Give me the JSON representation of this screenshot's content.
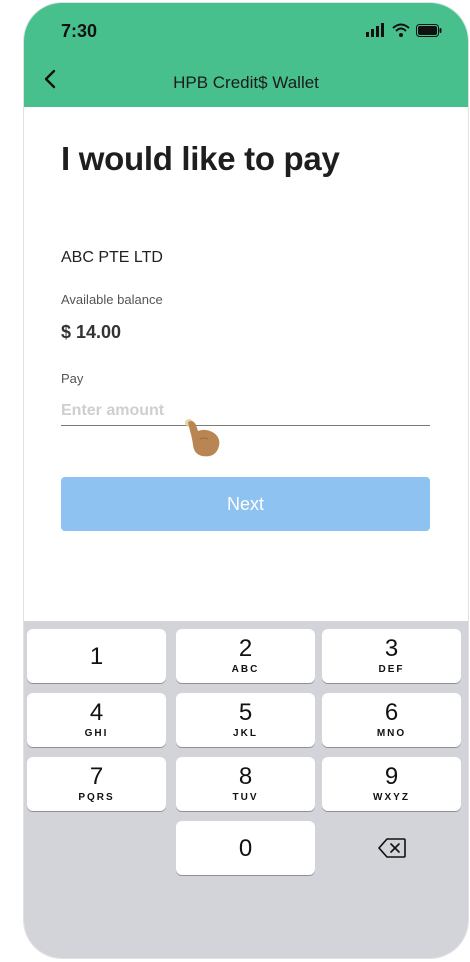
{
  "status_bar": {
    "time": "7:30"
  },
  "nav": {
    "title": "HPB Credit$ Wallet"
  },
  "main": {
    "headline": "I would like to pay",
    "merchant": "ABC PTE LTD",
    "balance_label": "Available balance",
    "balance_value": "$ 14.00",
    "pay_label": "Pay",
    "amount_placeholder": "Enter amount",
    "amount_value": "",
    "next_label": "Next"
  },
  "keypad": {
    "keys": [
      {
        "digit": "1",
        "letters": ""
      },
      {
        "digit": "2",
        "letters": "ABC"
      },
      {
        "digit": "3",
        "letters": "DEF"
      },
      {
        "digit": "4",
        "letters": "GHI"
      },
      {
        "digit": "5",
        "letters": "JKL"
      },
      {
        "digit": "6",
        "letters": "MNO"
      },
      {
        "digit": "7",
        "letters": "PQRS"
      },
      {
        "digit": "8",
        "letters": "TUV"
      },
      {
        "digit": "9",
        "letters": "WXYZ"
      },
      {
        "digit": "0",
        "letters": ""
      }
    ],
    "delete_icon": "backspace-icon"
  },
  "colors": {
    "header": "#48c08e",
    "button": "#8ec2f1",
    "keypad_bg": "#d2d4d9"
  },
  "icons": [
    "back-chevron-icon",
    "signal-icon",
    "wifi-icon",
    "battery-icon",
    "hand-pointer-icon",
    "backspace-icon"
  ]
}
